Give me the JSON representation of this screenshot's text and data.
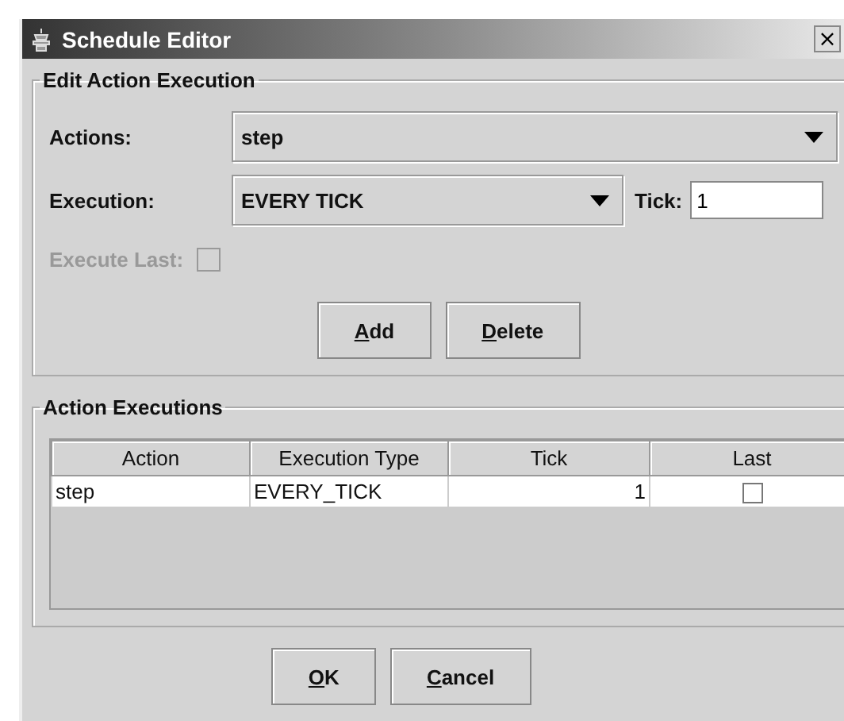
{
  "window": {
    "title": "Schedule Editor",
    "close": "×"
  },
  "edit_group": {
    "title": "Edit Action Execution",
    "actions": {
      "label": "Actions:",
      "value": "step"
    },
    "execution": {
      "label": "Execution:",
      "value": "EVERY TICK"
    },
    "tick": {
      "label": "Tick:",
      "value": "1"
    },
    "execute_last": {
      "label": "Execute Last:",
      "checked": false,
      "disabled": true
    },
    "buttons": [
      {
        "label": "Add",
        "first_letter_underlined": true
      },
      {
        "label": "Delete",
        "first_letter_underlined": true
      }
    ]
  },
  "list_group": {
    "title": "Action Executions",
    "table": {
      "columns": [
        "Action",
        "Execution Type",
        "Tick",
        "Last"
      ],
      "rows": [
        {
          "action": "step",
          "execution_type": "EVERY_TICK",
          "tick": "1",
          "last": false
        }
      ]
    }
  },
  "buttons": [
    {
      "label": "OK",
      "first_letter_underlined": true
    },
    {
      "label": "Cancel",
      "first_letter_underlined": true
    }
  ]
}
